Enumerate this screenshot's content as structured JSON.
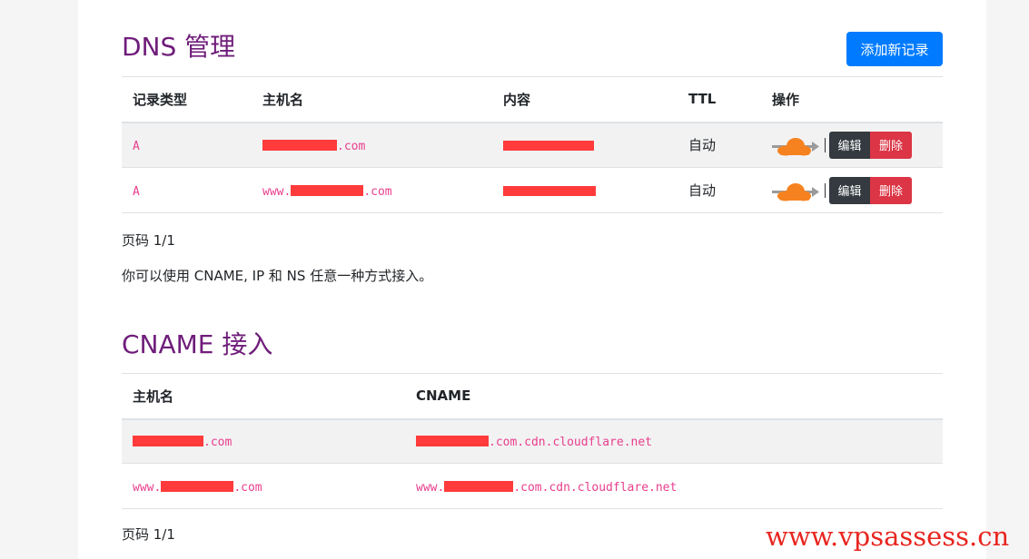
{
  "dns": {
    "title": "DNS 管理",
    "add_button": "添加新记录",
    "headers": [
      "记录类型",
      "主机名",
      "内容",
      "TTL",
      "操作"
    ],
    "rows": [
      {
        "type": "A",
        "host_prefix": "",
        "host_suffix": ".com",
        "ttl": "自动",
        "edit": "编辑",
        "delete": "删除"
      },
      {
        "type": "A",
        "host_prefix": "www.",
        "host_suffix": ".com",
        "ttl": "自动",
        "edit": "编辑",
        "delete": "删除"
      }
    ],
    "pagination": "页码 1/1",
    "note": "你可以使用 CNAME, IP 和 NS 任意一种方式接入。"
  },
  "cname": {
    "title": "CNAME 接入",
    "headers": [
      "主机名",
      "CNAME"
    ],
    "rows": [
      {
        "host_prefix": "",
        "host_suffix": ".com",
        "cname_prefix": "",
        "cname_suffix": ".com.cdn.cloudflare.net"
      },
      {
        "host_prefix": "www.",
        "host_suffix": ".com",
        "cname_prefix": "www.",
        "cname_suffix": ".com.cdn.cloudflare.net"
      }
    ],
    "pagination": "页码 1/1"
  },
  "colors": {
    "title": "#6f1d7a",
    "primary": "#007bff",
    "code": "#e83e8c",
    "redaction": "#ff3b3b",
    "cloud": "#f6821f"
  },
  "icons": [
    "cloudflare-proxy-icon"
  ],
  "watermark": "www.vpsassess.cn"
}
